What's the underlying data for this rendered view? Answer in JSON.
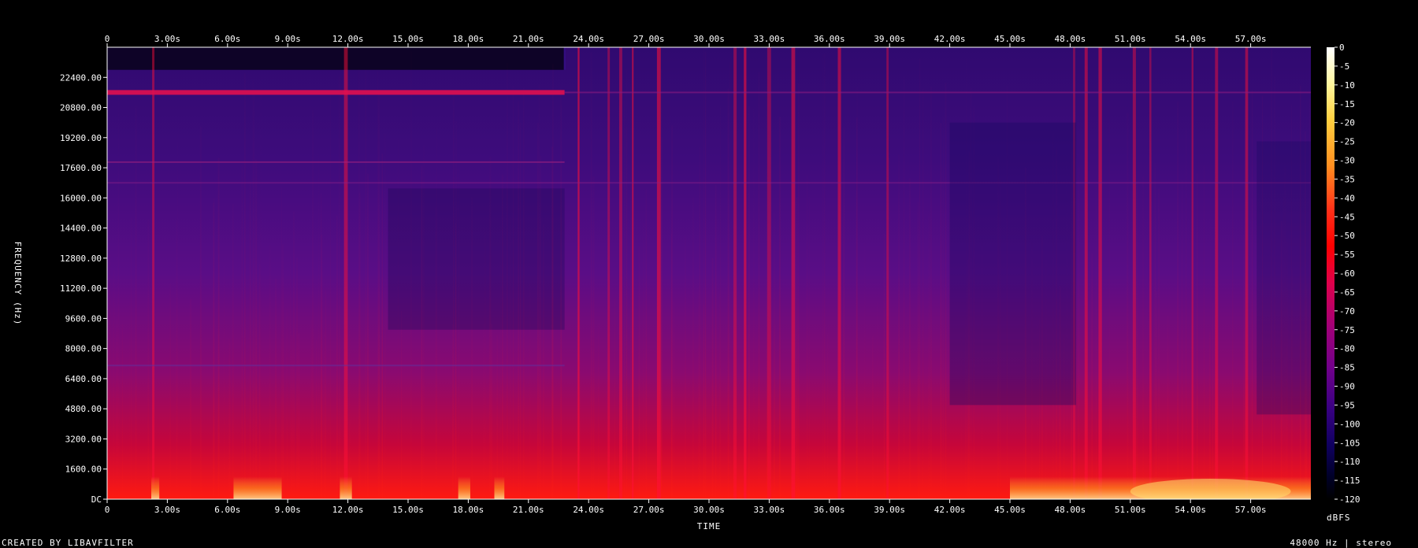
{
  "chart_data": {
    "type": "heatmap",
    "xlabel": "TIME",
    "ylabel": "FREQUENCY (Hz)",
    "x_unit": "s",
    "x_range": [
      0,
      60
    ],
    "y_range": [
      0,
      24000
    ],
    "x_ticks": [
      0,
      3,
      6,
      9,
      12,
      15,
      18,
      21,
      24,
      27,
      30,
      33,
      36,
      39,
      42,
      45,
      48,
      51,
      54,
      57
    ],
    "x_tick_labels": [
      "0",
      "3.00s",
      "6.00s",
      "9.00s",
      "12.00s",
      "15.00s",
      "18.00s",
      "21.00s",
      "24.00s",
      "27.00s",
      "30.00s",
      "33.00s",
      "36.00s",
      "39.00s",
      "42.00s",
      "45.00s",
      "48.00s",
      "51.00s",
      "54.00s",
      "57.00s"
    ],
    "y_ticks": [
      0,
      1600,
      3200,
      4800,
      6400,
      8000,
      9600,
      11200,
      12800,
      14400,
      16000,
      17600,
      19200,
      20800,
      22400
    ],
    "y_tick_labels": [
      "DC",
      "1600.00",
      "3200.00",
      "4800.00",
      "6400.00",
      "8000.00",
      "9600.00",
      "11200.00",
      "12800.00",
      "14400.00",
      "16000.00",
      "17600.00",
      "19200.00",
      "20800.00",
      "22400.00"
    ],
    "colorbar": {
      "unit": "dBFS",
      "range": [
        -120,
        0
      ],
      "ticks": [
        0,
        -5,
        -10,
        -15,
        -20,
        -25,
        -30,
        -35,
        -40,
        -45,
        -50,
        -55,
        -60,
        -65,
        -70,
        -75,
        -80,
        -85,
        -90,
        -95,
        -100,
        -105,
        -110,
        -115,
        -120
      ],
      "tick_labels": [
        "0",
        "-5",
        "-10",
        "-15",
        "-20",
        "-25",
        "-30",
        "-35",
        "-40",
        "-45",
        "-50",
        "-55",
        "-60",
        "-65",
        "-70",
        "-75",
        "-80",
        "-85",
        "-90",
        "-95",
        "-100",
        "-105",
        "-110",
        "-115",
        "-120"
      ],
      "colors": [
        "#ffffff",
        "#fff7a0",
        "#ffd040",
        "#ff9020",
        "#ff3018",
        "#ff0000",
        "#e0004a",
        "#a00078",
        "#70008a",
        "#380082",
        "#100060",
        "#000028",
        "#000000"
      ]
    },
    "features": {
      "band_freq_hz": 21600,
      "band_end_s": 22.8,
      "quiet_top_end_s": 22.8,
      "bright_segments_s": [
        [
          2.2,
          2.6
        ],
        [
          6.3,
          8.7
        ],
        [
          11.6,
          12.2
        ],
        [
          17.5,
          18.1
        ],
        [
          19.3,
          19.8
        ],
        [
          45,
          60
        ]
      ],
      "strong_transients_s": [
        2.3,
        11.9,
        23.5,
        25,
        25.6,
        26.2,
        27.5,
        31.3,
        31.8,
        33,
        34.2,
        36.5,
        38.9,
        48.2,
        48.8,
        49.5,
        51.2,
        52,
        54.1,
        55.3,
        56.8
      ]
    }
  },
  "footer": {
    "credit": "CREATED BY LIBAVFILTER",
    "info": "48000 Hz | stereo"
  }
}
